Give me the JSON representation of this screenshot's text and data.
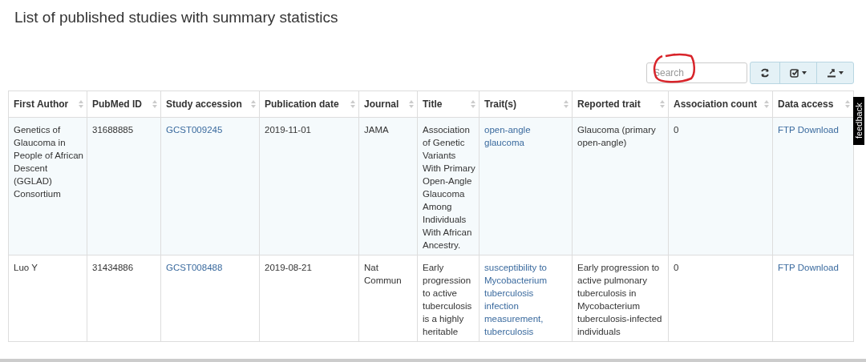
{
  "page_title": "List of published studies with summary statistics",
  "search": {
    "placeholder": "Search"
  },
  "feedback_tab": {
    "label": "feedback"
  },
  "table": {
    "columns": [
      {
        "label": "First Author",
        "kind": "text"
      },
      {
        "label": "PubMed ID",
        "kind": "text"
      },
      {
        "label": "Study accession",
        "kind": "link"
      },
      {
        "label": "Publication date",
        "kind": "text"
      },
      {
        "label": "Journal",
        "kind": "text"
      },
      {
        "label": "Title",
        "kind": "text"
      },
      {
        "label": "Trait(s)",
        "kind": "link"
      },
      {
        "label": "Reported trait",
        "kind": "text"
      },
      {
        "label": "Association count",
        "kind": "text"
      },
      {
        "label": "Data access",
        "kind": "link"
      }
    ],
    "rows": [
      {
        "cells": [
          "Genetics of Glaucoma in People of African Descent (GGLAD) Consortium",
          "31688885",
          "GCST009245",
          "2019-11-01",
          "JAMA",
          "Association of Genetic Variants With Primary Open-Angle Glaucoma Among Individuals With African Ancestry.",
          "open-angle glaucoma",
          "Glaucoma (primary open-angle)",
          "0",
          "FTP Download"
        ]
      },
      {
        "cells": [
          "Luo Y",
          "31434886",
          "GCST008488",
          "2019-08-21",
          "Nat Commun",
          "Early progression to active tuberculosis is a highly heritable",
          "susceptibility to Mycobacterium tuberculosis infection measurement, tuberculosis",
          "Early progression to active pulmonary tuberculosis in Mycobacterium tuberculosis-infected individuals",
          "0",
          "FTP Download"
        ]
      }
    ]
  }
}
